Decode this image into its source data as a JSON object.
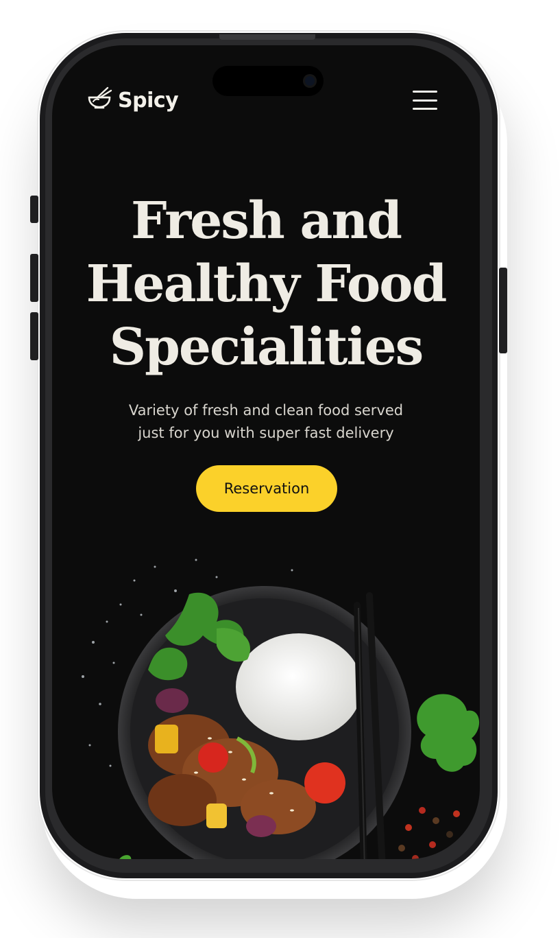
{
  "brand": {
    "name": "Spicy",
    "logo_icon": "bowl-chopsticks-icon"
  },
  "nav": {
    "menu_icon": "hamburger-menu-icon"
  },
  "hero": {
    "title_line1": "Fresh and",
    "title_line2": "Healthy Food",
    "title_line3": "Specialities",
    "subtitle_line1": "Variety of fresh and clean food served",
    "subtitle_line2": "just for you with super fast delivery",
    "cta_label": "Reservation"
  },
  "colors": {
    "background": "#0c0c0c",
    "accent": "#fbd12a",
    "text": "#efece4"
  }
}
